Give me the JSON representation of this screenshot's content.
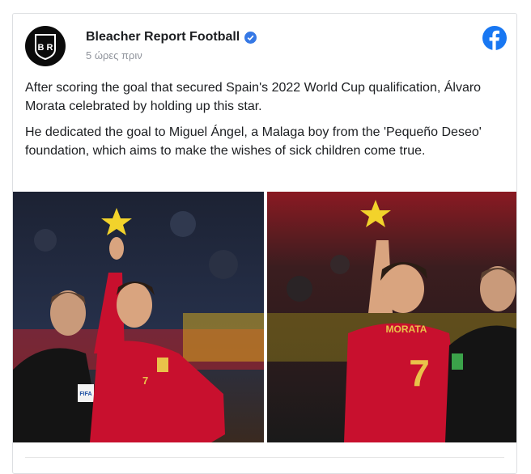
{
  "post": {
    "page_name": "Bleacher Report Football",
    "timestamp": "5 ώρες πριν",
    "paragraphs": [
      "After scoring the goal that secured Spain's 2022 World Cup qualification, Álvaro Morata celebrated by holding up this star.",
      "He dedicated the goal to Miguel Ángel, a Malaga boy from the 'Pequeño Deseo' foundation, which aims to make the wishes of sick children come true."
    ],
    "avatar_text": "B R",
    "jersey_name": "MORATA",
    "jersey_number": "7",
    "ref_badge": "FIFA"
  },
  "icons": {
    "verified": "verified-badge-icon",
    "facebook": "facebook-logo-icon",
    "star": "star-icon"
  },
  "colors": {
    "facebook_blue": "#1877f2",
    "verified_blue": "#3578e5",
    "jersey_red": "#c8102e",
    "star_yellow": "#f2d32b"
  }
}
